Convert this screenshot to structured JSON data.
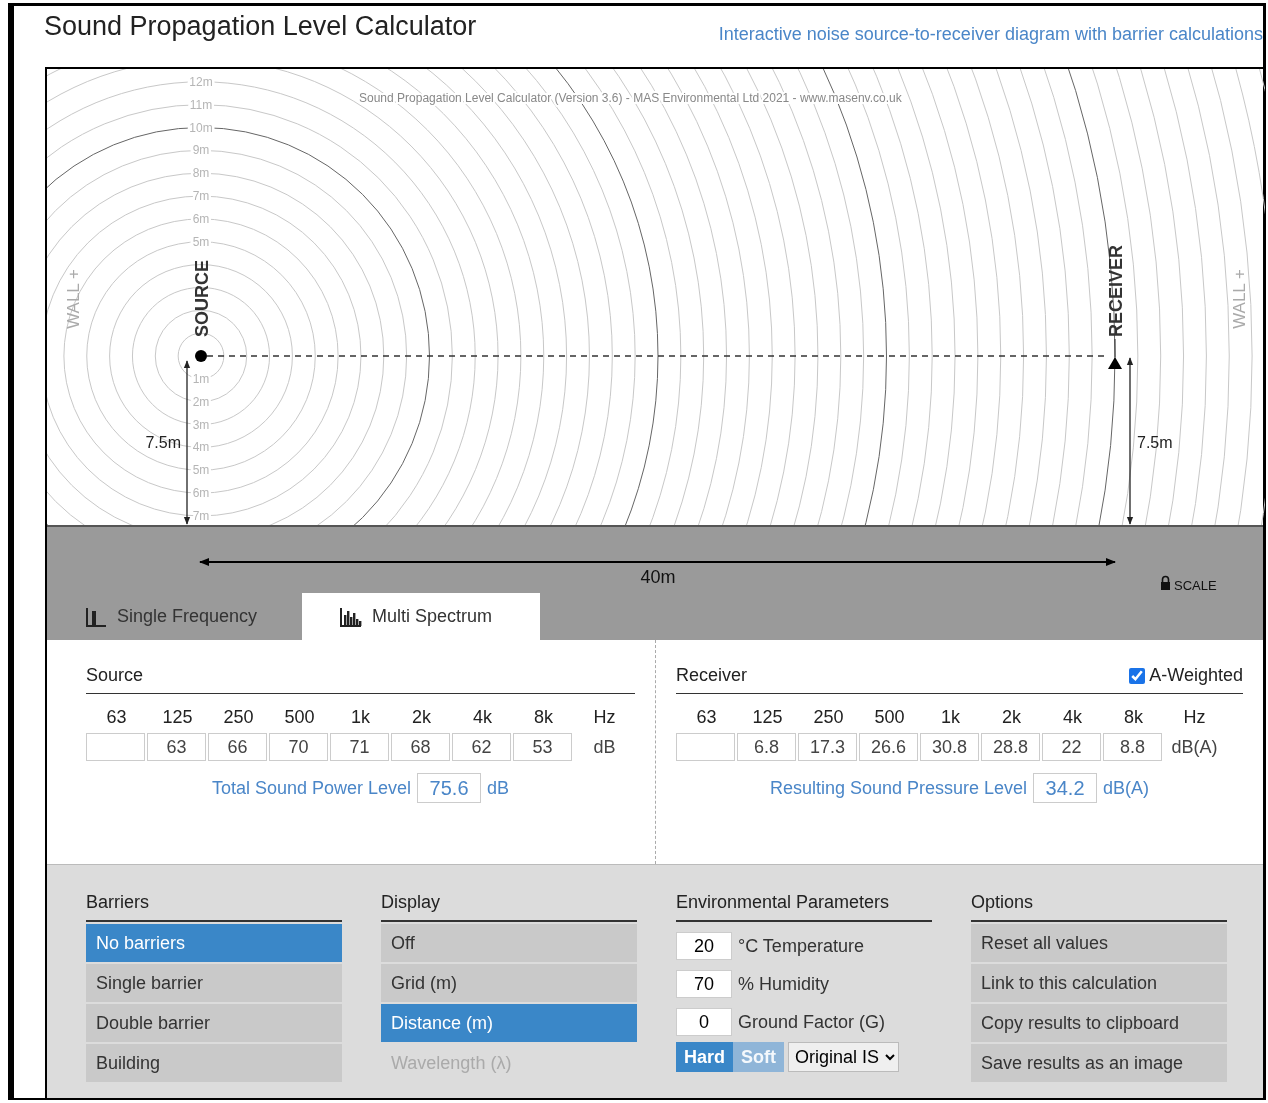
{
  "header": {
    "title": "Sound Propagation Level Calculator",
    "subtitle": "Interactive noise source-to-receiver diagram with barrier calculations"
  },
  "diagram": {
    "credit": "Sound Propagation Level Calculator (Version 3.6) - MAS Environmental Ltd 2021 - www.masenv.co.uk",
    "upper_ticks": [
      "12m",
      "11m",
      "10m",
      "9m",
      "8m",
      "7m",
      "6m",
      "5m"
    ],
    "lower_ticks": [
      "1m",
      "2m",
      "3m",
      "4m",
      "5m",
      "6m",
      "7m"
    ],
    "left_wall": "WALL +",
    "right_wall": "WALL +",
    "source_label": "SOURCE",
    "receiver_label": "RECEIVER",
    "source_height": "7.5m",
    "receiver_height": "7.5m",
    "distance": "40m",
    "scale_label": "SCALE"
  },
  "tabs": [
    {
      "label": "Single Frequency",
      "kind": "single",
      "selected": false
    },
    {
      "label": "Multi Spectrum",
      "kind": "multi",
      "selected": true
    }
  ],
  "source": {
    "title": "Source",
    "bands": [
      "63",
      "125",
      "250",
      "500",
      "1k",
      "2k",
      "4k",
      "8k"
    ],
    "band_unit": "Hz",
    "leading_blank": true,
    "levels": [
      "63",
      "66",
      "70",
      "71",
      "68",
      "62",
      "53"
    ],
    "level_unit": "dB",
    "total": {
      "label": "Total Sound Power Level",
      "value": "75.6",
      "unit": "dB"
    }
  },
  "receiver": {
    "title": "Receiver",
    "a_weighted": {
      "label": "A-Weighted",
      "checked": true
    },
    "bands": [
      "63",
      "125",
      "250",
      "500",
      "1k",
      "2k",
      "4k",
      "8k"
    ],
    "band_unit": "Hz",
    "leading_blank": true,
    "levels": [
      "6.8",
      "17.3",
      "26.6",
      "30.8",
      "28.8",
      "22",
      "8.8"
    ],
    "level_unit": "dB(A)",
    "total": {
      "label": "Resulting Sound Pressure Level",
      "value": "34.2",
      "unit": "dB(A)"
    }
  },
  "barriers": {
    "title": "Barriers",
    "items": [
      {
        "label": "No barriers",
        "selected": true
      },
      {
        "label": "Single barrier",
        "selected": false
      },
      {
        "label": "Double barrier",
        "selected": false
      },
      {
        "label": "Building",
        "selected": false
      }
    ]
  },
  "display": {
    "title": "Display",
    "items": [
      {
        "label": "Off",
        "selected": false,
        "disabled": false
      },
      {
        "label": "Grid (m)",
        "selected": false,
        "disabled": false
      },
      {
        "label": "Distance (m)",
        "selected": true,
        "disabled": false
      },
      {
        "label": "Wavelength (λ)",
        "selected": false,
        "disabled": true
      }
    ]
  },
  "environment": {
    "title": "Environmental Parameters",
    "fields": [
      {
        "value": "20",
        "label": "°C Temperature"
      },
      {
        "value": "70",
        "label": "% Humidity"
      },
      {
        "value": "0",
        "label": "Ground Factor (G)"
      }
    ],
    "ground_type": [
      {
        "label": "Hard",
        "selected": true
      },
      {
        "label": "Soft",
        "selected": false
      }
    ],
    "method": {
      "value": "Original IS"
    }
  },
  "options": {
    "title": "Options",
    "buttons": [
      "Reset all values",
      "Link to this calculation",
      "Copy results to clipboard",
      "Save results as an image"
    ]
  }
}
